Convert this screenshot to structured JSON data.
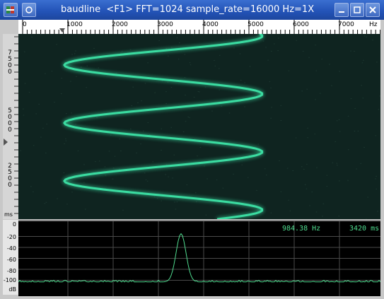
{
  "window": {
    "title": "baudline  <F1> FFT=1024 sample_rate=16000 Hz=1X",
    "app_icon": "baudline-app-icon",
    "buttons": [
      "menu-icon",
      "minimize-icon",
      "maximize-icon",
      "close-icon"
    ]
  },
  "freq_axis": {
    "labels": [
      "0",
      "1000",
      "2000",
      "3000",
      "4000",
      "5000",
      "6000",
      "7000",
      "Hz"
    ],
    "cursor_hz": 984.38
  },
  "time_axis": {
    "labels": [
      {
        "text": [
          "7",
          "5",
          "0",
          "0"
        ]
      },
      {
        "text": [
          "5",
          "0",
          "0",
          "0"
        ]
      },
      {
        "text": [
          "2",
          "5",
          "0",
          "0"
        ]
      }
    ],
    "unit": "ms"
  },
  "spectrum": {
    "db_labels": [
      "0",
      "-20",
      "-40",
      "-60",
      "-80",
      "-100",
      "dB"
    ],
    "readout_freq": "984.38 Hz",
    "readout_time": "3420 ms",
    "peak_db": -15,
    "peak_hz": 3500,
    "noise_floor_db": -103
  },
  "colors": {
    "trace": "#4fdc8f",
    "spectro_bg": "#0f2420",
    "chirp": "#3ff0b0"
  }
}
